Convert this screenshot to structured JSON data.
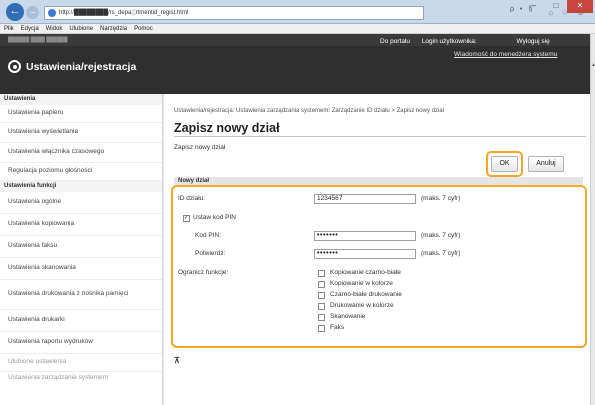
{
  "browser": {
    "url": "http://████████/rs_depa░rtmentid_regist.html",
    "tools": "ρ • §",
    "menu": [
      "Plik",
      "Edycja",
      "Widok",
      "Ulubione",
      "Narzędzia",
      "Pomoc"
    ],
    "window_buttons": [
      "–",
      "□",
      "✕"
    ]
  },
  "header": {
    "product_name": "██████ ████ ██████",
    "portal_link": "Do portalu",
    "login_user": "Login użytkownika:",
    "logout_link": "Wyloguj się",
    "message_link": "Wiadomość do menedżera systemu",
    "title": "Ustawienia/rejestracja"
  },
  "sidebar": {
    "section1": "Ustawienia",
    "items1": [
      "Ustawienia papieru",
      "Ustawienia wyświetlania",
      "Ustawienia włącznika czasowego",
      "Regulacja poziomu głośności"
    ],
    "section2": "Ustawienia funkcji",
    "items2": [
      "Ustawienia ogólne",
      "Ustawienia kopiowania",
      "Ustawienia faksu",
      "Ustawienia skanowania",
      "Ustawienia drukowania z nośnika pamięci",
      "Ustawienia drukarki",
      "Ustawienia raportu wydruków",
      "Ulubione ustawienia",
      "Ustawienia zarządzania systemem"
    ]
  },
  "main": {
    "breadcrumb": "Ustawienia/rejestracja: Ustawienia zarządzania systemem: Zarządzanie ID działu > Zapisz nowy dział",
    "title": "Zapisz nowy dział",
    "subtitle": "Zapisz nowy dział",
    "ok": "OK",
    "cancel": "Anuluj",
    "section": "Nowy dział",
    "id_label": "ID działu:",
    "id_value": "1234567",
    "id_hint": "(maks. 7 cyfr)",
    "pin_checkbox": "Ustaw kod PIN",
    "pin_label": "Kod PIN:",
    "pin_value": "•••••••",
    "pin_hint": "(maks. 7 cyfr)",
    "confirm_label": "Potwierdź:",
    "confirm_value": "•••••••",
    "confirm_hint": "(maks. 7 cyfr)",
    "restrict_label": "Ogranicz funkcje:",
    "functions": [
      "Kopiowanie czarno-białe",
      "Kopiowanie w kolorze",
      "Czarno-białe drukowanie",
      "Drukowanie w kolorze",
      "Skanowanie",
      "Faks"
    ],
    "top_link": "⊼"
  },
  "colors": {
    "highlight": "#f6a623",
    "header_bg": "#2f2f2f"
  }
}
